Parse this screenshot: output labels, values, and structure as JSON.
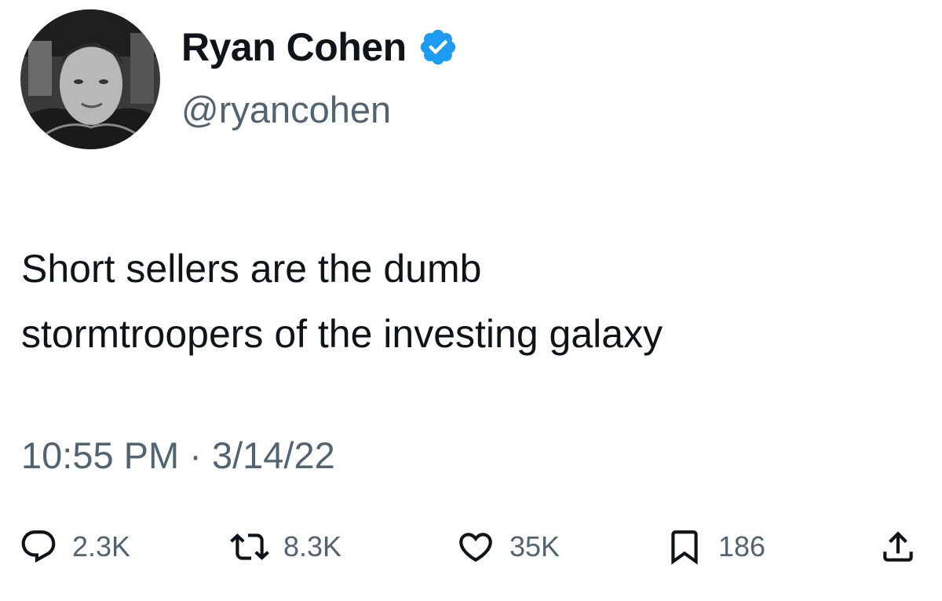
{
  "user": {
    "display_name": "Ryan Cohen",
    "handle": "@ryancohen",
    "verified_icon": "verified-badge-icon",
    "verified_color": "#1d9bf0"
  },
  "tweet": {
    "lines": [
      "Short sellers are the dumb",
      "stormtroopers of the investing galaxy"
    ],
    "timestamp": "10:55 PM · 3/14/22"
  },
  "actions": {
    "reply": {
      "icon": "reply-icon",
      "count": "2.3K"
    },
    "retweet": {
      "icon": "retweet-icon",
      "count": "8.3K"
    },
    "like": {
      "icon": "heart-icon",
      "count": "35K"
    },
    "bookmark": {
      "icon": "bookmark-icon",
      "count": "186"
    },
    "share": {
      "icon": "share-icon"
    }
  },
  "colors": {
    "text_primary": "#0f1419",
    "text_secondary": "#536471",
    "accent": "#1d9bf0"
  }
}
